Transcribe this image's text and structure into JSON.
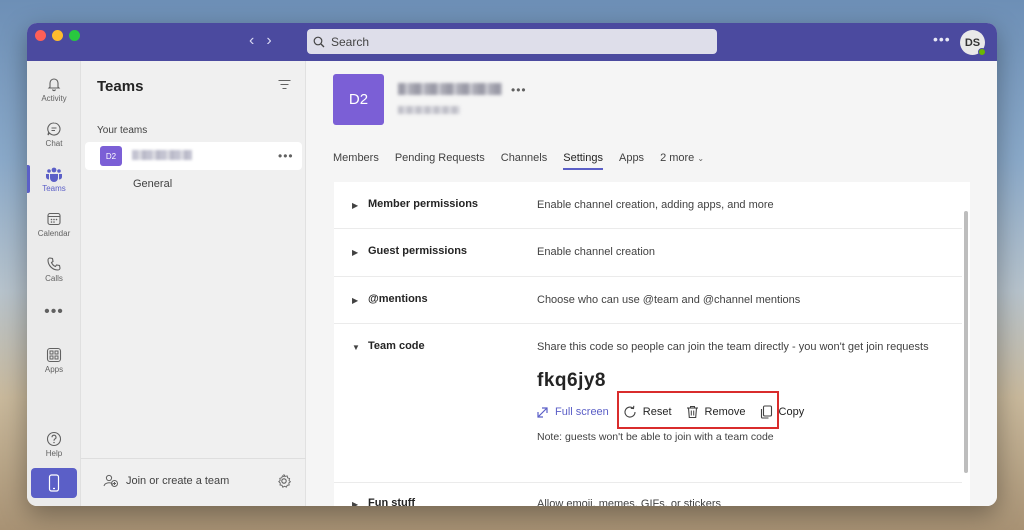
{
  "titlebar": {
    "search_placeholder": "Search",
    "user_initials": "DS"
  },
  "rail": {
    "items": [
      {
        "label": "Activity",
        "icon": "bell-icon"
      },
      {
        "label": "Chat",
        "icon": "chat-icon"
      },
      {
        "label": "Teams",
        "icon": "teams-icon",
        "active": true
      },
      {
        "label": "Calendar",
        "icon": "calendar-icon"
      },
      {
        "label": "Calls",
        "icon": "phone-icon"
      },
      {
        "label": "Apps",
        "icon": "apps-icon"
      },
      {
        "label": "Help",
        "icon": "help-icon"
      }
    ]
  },
  "panel": {
    "title": "Teams",
    "section_label": "Your teams",
    "team_initials": "D2",
    "channel": "General",
    "join_create": "Join or create a team"
  },
  "main": {
    "team_initials": "D2",
    "tabs": [
      "Members",
      "Pending Requests",
      "Channels",
      "Settings",
      "Apps",
      "2 more"
    ],
    "active_tab": "Settings",
    "settings": [
      {
        "name": "Member permissions",
        "desc": "Enable channel creation, adding apps, and more",
        "expanded": false
      },
      {
        "name": "Guest permissions",
        "desc": "Enable channel creation",
        "expanded": false
      },
      {
        "name": "@mentions",
        "desc": "Choose who can use @team and @channel mentions",
        "expanded": false
      },
      {
        "name": "Team code",
        "desc": "Share this code so people can join the team directly - you won't get join requests",
        "expanded": true
      },
      {
        "name": "Fun stuff",
        "desc": "Allow emoji, memes, GIFs, or stickers",
        "expanded": false
      }
    ],
    "team_code": "fkq6jy8",
    "actions": {
      "fullscreen": "Full screen",
      "reset": "Reset",
      "remove": "Remove",
      "copy": "Copy"
    },
    "note": "Note: guests won't be able to join with a team code"
  },
  "colors": {
    "titlebar": "#4b4a9f",
    "accent": "#5b5fc7",
    "team_avatar": "#7b5fd6",
    "highlight": "#d92c2c"
  }
}
